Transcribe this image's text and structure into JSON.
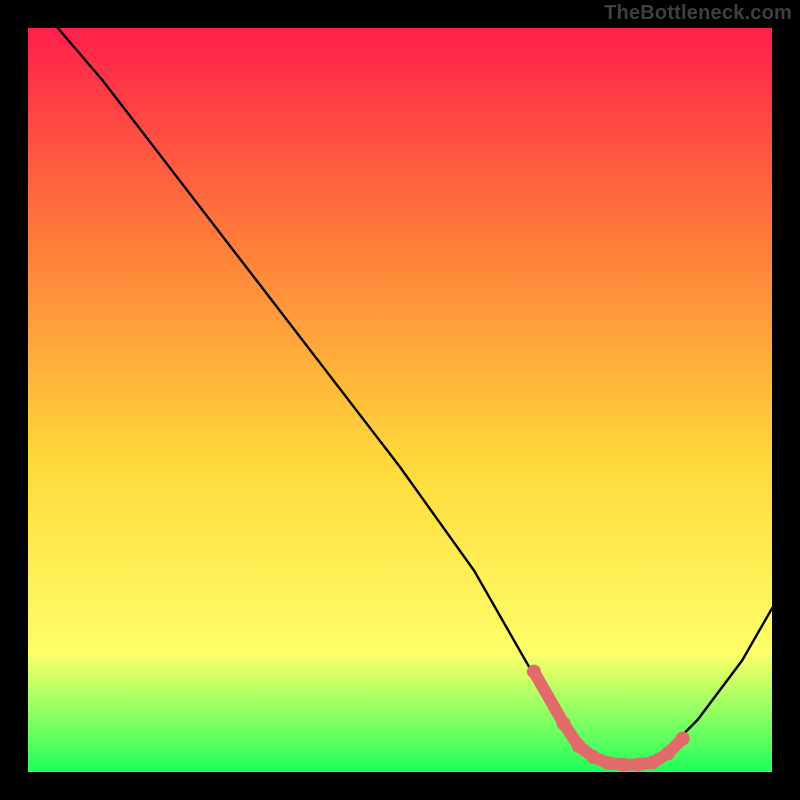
{
  "watermark": "TheBottleneck.com",
  "colors": {
    "gradient_top": "#ff1f4b",
    "gradient_mid_upper": "#ff7a3a",
    "gradient_mid": "#ffd83a",
    "gradient_mid_lower": "#ffff6a",
    "gradient_bottom": "#1fff5a",
    "background": "#000000",
    "curve": "#000000",
    "marker": "#e26a6a"
  },
  "chart_data": {
    "type": "line",
    "title": "",
    "xlabel": "",
    "ylabel": "",
    "xlim": [
      0,
      100
    ],
    "ylim": [
      0,
      100
    ],
    "grid": false,
    "legend": false,
    "series": [
      {
        "name": "bottleneck-curve",
        "x": [
          4,
          10,
          20,
          30,
          40,
          50,
          60,
          68,
          72,
          74,
          76,
          78,
          80,
          82,
          84,
          86,
          90,
          96,
          100
        ],
        "y": [
          100,
          93,
          80,
          67,
          54,
          41,
          27,
          13,
          6,
          3,
          1.5,
          1,
          1,
          1,
          1.5,
          3,
          7,
          15,
          22
        ]
      }
    ],
    "markers": {
      "name": "sweet-spot",
      "x": [
        68,
        72,
        74,
        76,
        78,
        80,
        82,
        84,
        86,
        88
      ],
      "y": [
        13.5,
        6.5,
        3.5,
        2,
        1.2,
        1,
        1,
        1.3,
        2.5,
        4.5
      ]
    }
  }
}
